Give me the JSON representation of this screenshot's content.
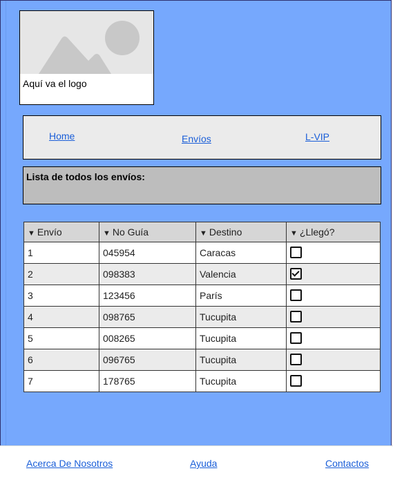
{
  "logo": {
    "caption": "Aquí va el logo"
  },
  "nav": {
    "home": "Home",
    "envios": "Envíos",
    "lvip": "L-VIP"
  },
  "list_title": "Lista de todos los envíos:",
  "table": {
    "headers": [
      "Envío",
      "No Guía",
      "Destino",
      "¿Llegó?"
    ],
    "rows": [
      {
        "envio": "1",
        "guia": "045954",
        "destino": "Caracas",
        "llego": false
      },
      {
        "envio": "2",
        "guia": "098383",
        "destino": "Valencia",
        "llego": true
      },
      {
        "envio": "3",
        "guia": "123456",
        "destino": "París",
        "llego": false
      },
      {
        "envio": "4",
        "guia": "098765",
        "destino": "Tucupita",
        "llego": false
      },
      {
        "envio": "5",
        "guia": "008265",
        "destino": "Tucupita",
        "llego": false
      },
      {
        "envio": "6",
        "guia": "096765",
        "destino": "Tucupita",
        "llego": false
      },
      {
        "envio": "7",
        "guia": "178765",
        "destino": "Tucupita",
        "llego": false
      }
    ]
  },
  "footer": {
    "about": "Acerca De Nosotros",
    "help": "Ayuda",
    "contacts": "Contactos"
  },
  "colors": {
    "page_bg": "#76a8fd",
    "link": "#1a5ed8",
    "nav_bg": "#ebebeb",
    "title_bg": "#bdbdbd"
  }
}
